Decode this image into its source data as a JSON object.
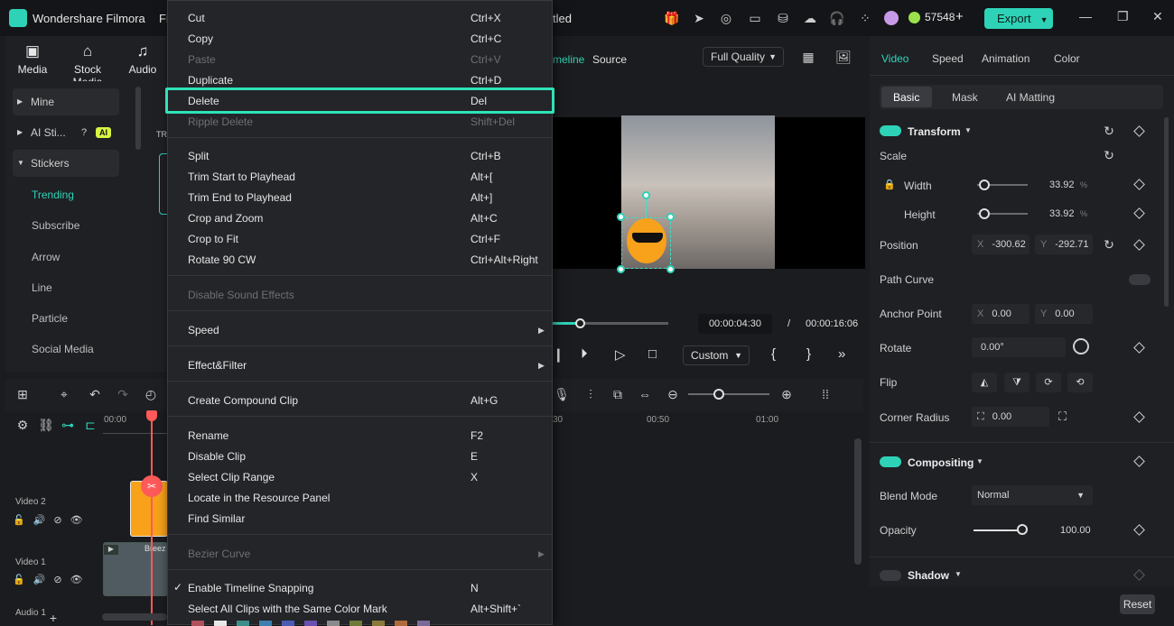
{
  "app": {
    "name": "Wondershare Filmora",
    "partial_menu": "Fi",
    "partial_title": "tled",
    "credits": "57548",
    "export_label": "Export"
  },
  "media_tabs": [
    {
      "label": "Media"
    },
    {
      "label": "Stock Media"
    },
    {
      "label": "Audio"
    }
  ],
  "sidebar": {
    "items": [
      {
        "label": "Mine"
      },
      {
        "label": "AI Sti..."
      },
      {
        "label": "Stickers"
      }
    ],
    "ai_badge": "AI",
    "sub_items": [
      {
        "label": "Trending"
      },
      {
        "label": "Subscribe"
      },
      {
        "label": "Arrow"
      },
      {
        "label": "Line"
      },
      {
        "label": "Particle"
      },
      {
        "label": "Social Media"
      }
    ],
    "partial_tr": "TR"
  },
  "preview": {
    "tab_timeline": "meline",
    "tab_source": "Source",
    "quality": "Full Quality",
    "current_time": "00:00:04:30",
    "separator": "/",
    "total_time": "00:00:16:06",
    "zoom": "Custom"
  },
  "timeline": {
    "ruler": [
      "00:00",
      "30",
      "00:50",
      "01:00"
    ],
    "tracks": [
      {
        "label": "Video 2"
      },
      {
        "label": "Video 1"
      },
      {
        "label": "Audio 1"
      }
    ],
    "clip_label": "Breez"
  },
  "right_panel": {
    "tabs": [
      {
        "label": "Video"
      },
      {
        "label": "Speed"
      },
      {
        "label": "Animation"
      },
      {
        "label": "Color"
      }
    ],
    "subtabs": [
      {
        "label": "Basic"
      },
      {
        "label": "Mask"
      },
      {
        "label": "AI Matting"
      }
    ],
    "transform": {
      "title": "Transform",
      "scale": "Scale",
      "width_label": "Width",
      "width_value": "33.92",
      "height_label": "Height",
      "height_value": "33.92",
      "unit": "%",
      "position_label": "Position",
      "pos_x_label": "X",
      "pos_x": "-300.62",
      "pos_y_label": "Y",
      "pos_y": "-292.71",
      "path_curve": "Path Curve",
      "anchor_label": "Anchor Point",
      "anchor_x": "0.00",
      "anchor_y": "0.00",
      "rotate_label": "Rotate",
      "rotate_value": "0.00°",
      "flip_label": "Flip",
      "corner_label": "Corner Radius",
      "corner_value": "0.00"
    },
    "compositing": {
      "title": "Compositing",
      "blend_label": "Blend Mode",
      "blend_value": "Normal",
      "opacity_label": "Opacity",
      "opacity_value": "100.00"
    },
    "shadow": {
      "title": "Shadow"
    },
    "reset_label": "Reset"
  },
  "context_menu": {
    "items": [
      {
        "label": "Cut",
        "shortcut": "Ctrl+X",
        "disabled": false
      },
      {
        "label": "Copy",
        "shortcut": "Ctrl+C",
        "disabled": false
      },
      {
        "label": "Paste",
        "shortcut": "Ctrl+V",
        "disabled": true
      },
      {
        "label": "Duplicate",
        "shortcut": "Ctrl+D",
        "disabled": false
      },
      {
        "label": "Delete",
        "shortcut": "Del",
        "disabled": false
      },
      {
        "label": "Ripple Delete",
        "shortcut": "Shift+Del",
        "disabled": true
      },
      {
        "label": "Split",
        "shortcut": "Ctrl+B",
        "disabled": false
      },
      {
        "label": "Trim Start to Playhead",
        "shortcut": "Alt+[",
        "disabled": false
      },
      {
        "label": "Trim End to Playhead",
        "shortcut": "Alt+]",
        "disabled": false
      },
      {
        "label": "Crop and Zoom",
        "shortcut": "Alt+C",
        "disabled": false
      },
      {
        "label": "Crop to Fit",
        "shortcut": "Ctrl+F",
        "disabled": false
      },
      {
        "label": "Rotate 90 CW",
        "shortcut": "Ctrl+Alt+Right",
        "disabled": false
      },
      {
        "label": "Disable Sound Effects",
        "shortcut": "",
        "disabled": true
      },
      {
        "label": "Speed",
        "shortcut": "",
        "disabled": false
      },
      {
        "label": "Effect&Filter",
        "shortcut": "",
        "disabled": false
      },
      {
        "label": "Create Compound Clip",
        "shortcut": "Alt+G",
        "disabled": false
      },
      {
        "label": "Rename",
        "shortcut": "F2",
        "disabled": false
      },
      {
        "label": "Disable Clip",
        "shortcut": "E",
        "disabled": false
      },
      {
        "label": "Select Clip Range",
        "shortcut": "X",
        "disabled": false
      },
      {
        "label": "Locate in the Resource Panel",
        "shortcut": "",
        "disabled": false
      },
      {
        "label": "Find Similar",
        "shortcut": "",
        "disabled": false
      },
      {
        "label": "Bezier Curve",
        "shortcut": "",
        "disabled": true
      },
      {
        "label": "Enable Timeline Snapping",
        "shortcut": "N",
        "disabled": false
      },
      {
        "label": "Select All Clips with the Same Color Mark",
        "shortcut": "Alt+Shift+`",
        "disabled": false
      }
    ],
    "check_mark": "✓",
    "highlighted": "Delete",
    "color_marks": [
      "#b0505a",
      "#e8e8e8",
      "#3a8f8a",
      "#3d7fb0",
      "#4b5bb5",
      "#6a4fb0",
      "#8a8a8a",
      "#6f7a3a",
      "#8a7a3a",
      "#b06a3a",
      "#7a6a9a"
    ]
  },
  "colors": {
    "accent": "#2ed3b7",
    "highlight_border": "#2ee3b8",
    "playhead": "#ff5a5a"
  }
}
